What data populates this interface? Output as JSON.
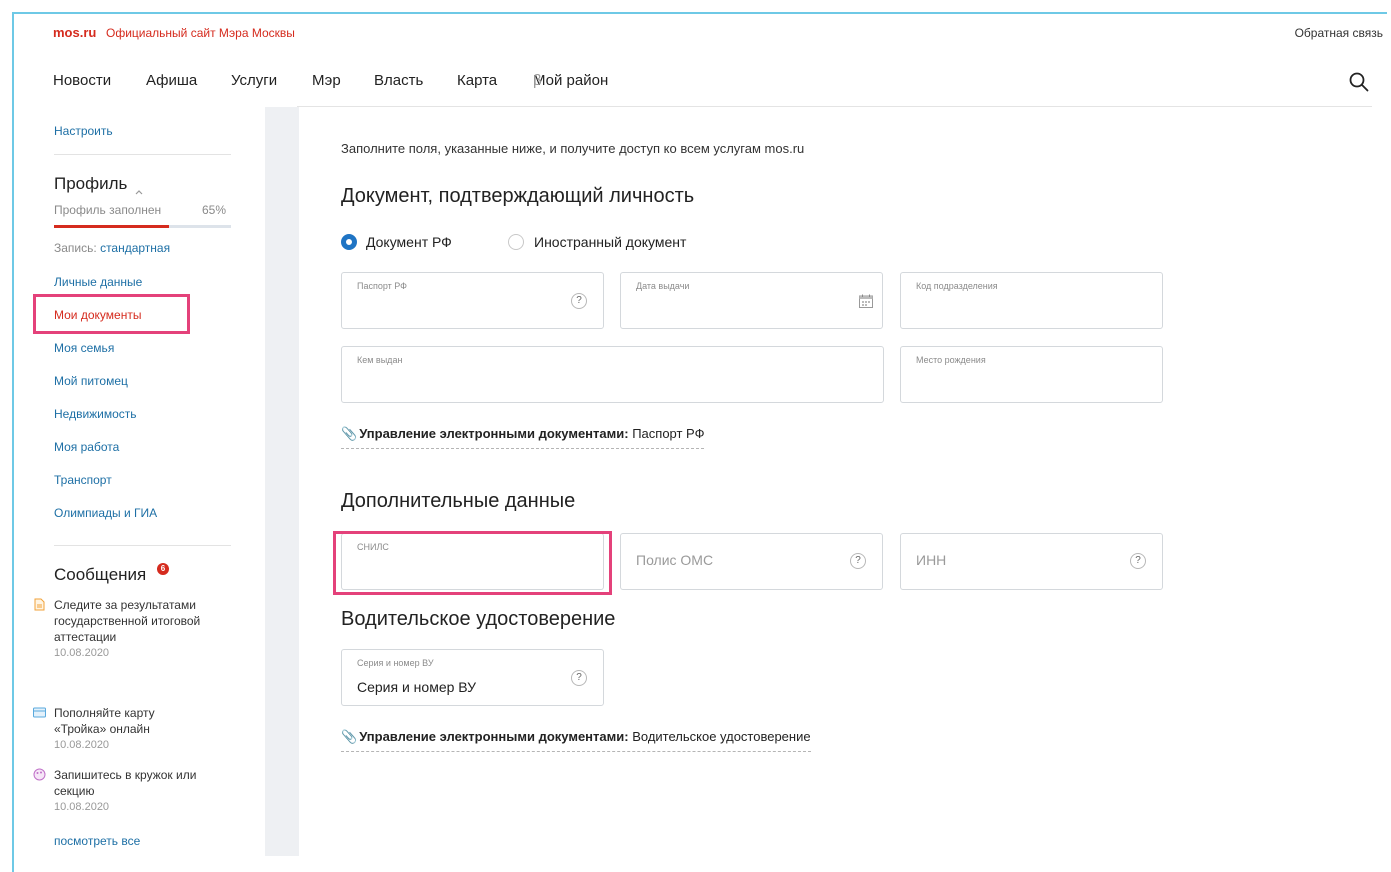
{
  "header": {
    "brand": "mos.ru",
    "brand_subtitle": "Официальный сайт Мэра Москвы",
    "feedback_link": "Обратная связь"
  },
  "nav": {
    "items": [
      "Новости",
      "Афиша",
      "Услуги",
      "Мэр",
      "Власть",
      "Карта",
      "Мой район"
    ],
    "beta_mark": "β"
  },
  "sidebar": {
    "customize_link": "Настроить",
    "profile_title": "Профиль",
    "profile_caret": "^",
    "profile_filled_label": "Профиль заполнен",
    "profile_filled_percent": "65%",
    "profile_progress": 0.65,
    "account_label": "Запись:",
    "account_type": "стандартная",
    "menu": [
      "Личные данные",
      "Мои документы",
      "Моя семья",
      "Мой питомец",
      "Недвижимость",
      "Моя работа",
      "Транспорт",
      "Олимпиады и ГИА"
    ],
    "active_item": "Мои документы",
    "messages_title": "Сообщения",
    "messages_badge": "6",
    "messages": [
      {
        "text": "Следите за результатами государственной итоговой аттестации",
        "date": "10.08.2020",
        "icon": "document-icon"
      },
      {
        "text": "Пополняйте карту «Тройка» онлайн",
        "date": "10.08.2020",
        "icon": "card-icon"
      },
      {
        "text": "Запишитесь в кружок или секцию",
        "date": "10.08.2020",
        "icon": "palette-icon"
      }
    ],
    "view_all": "посмотреть все"
  },
  "main": {
    "intro": "Заполните поля, указанные ниже, и получите доступ ко всем услугам mos.ru",
    "identity_section_title": "Документ, подтверждающий личность",
    "doc_type_options": [
      "Документ РФ",
      "Иностранный документ"
    ],
    "doc_type_selected": "Документ РФ",
    "fields": {
      "passport_label": "Паспорт РФ",
      "issue_date_label": "Дата выдачи",
      "dept_code_label": "Код подразделения",
      "issued_by_label": "Кем выдан",
      "birthplace_label": "Место рождения"
    },
    "edocs_prefix": "Управление электронными документами:",
    "edocs_passport": "Паспорт РФ",
    "extra_section_title": "Дополнительные данные",
    "snils_label": "СНИЛС",
    "oms_placeholder": "Полис ОМС",
    "inn_placeholder": "ИНН",
    "license_section_title": "Водительское удостоверение",
    "license_label": "Серия и номер ВУ",
    "license_value": "Серия и номер ВУ",
    "edocs_license": "Водительское удостоверение",
    "help_glyph": "?"
  },
  "colors": {
    "brand_red": "#d52b1e",
    "link_blue": "#1d6fa5",
    "highlight_pink": "#e4417a",
    "radio_blue": "#1f74c4"
  }
}
